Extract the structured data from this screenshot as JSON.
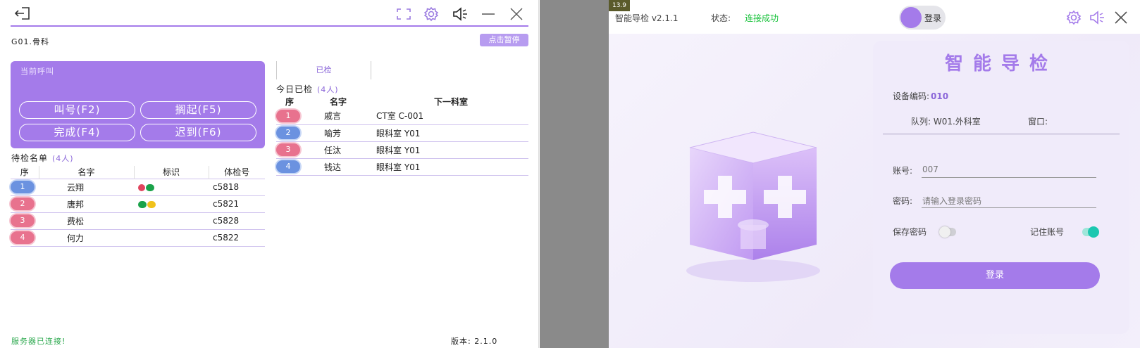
{
  "left": {
    "dept_label": "G01.骨科",
    "pause_button": "点击暂停",
    "call_panel": {
      "title": "当前呼叫",
      "buttons": [
        "叫号(F2)",
        "搁起(F5)",
        "完成(F4)",
        "迟到(F6)"
      ]
    },
    "waiting": {
      "title": "待检名单",
      "count": "(4人)",
      "headers": [
        "序",
        "名字",
        "标识",
        "体检号"
      ],
      "rows": [
        {
          "no": "1",
          "name": "云翔",
          "tags": [
            "heart",
            "green"
          ],
          "exam_id": "c5818",
          "badge": "blue"
        },
        {
          "no": "2",
          "name": "唐邦",
          "tags": [
            "green",
            "yellow"
          ],
          "exam_id": "c5821",
          "badge": "pink"
        },
        {
          "no": "3",
          "name": "费松",
          "tags": [],
          "exam_id": "c5828",
          "badge": "pink"
        },
        {
          "no": "4",
          "name": "何力",
          "tags": [],
          "exam_id": "c5822",
          "badge": "pink"
        }
      ]
    },
    "done_tab": "已检",
    "done": {
      "title": "今日已检",
      "count": "(4人)",
      "headers": [
        "序",
        "名字",
        "下一科室"
      ],
      "rows": [
        {
          "no": "1",
          "name": "戚言",
          "next": "CT室 C-001",
          "badge": "pink"
        },
        {
          "no": "2",
          "name": "喻芳",
          "next": "眼科室 Y01",
          "badge": "blue"
        },
        {
          "no": "3",
          "name": "任汰",
          "next": "眼科室 Y01",
          "badge": "pink"
        },
        {
          "no": "4",
          "name": "钱达",
          "next": "眼科室 Y01",
          "badge": "blue"
        }
      ]
    },
    "status": "服务器已连接!",
    "version": "版本: 2.1.0"
  },
  "right": {
    "fps": "13.9",
    "app_name": "智能导检 v2.1.1",
    "status_label": "状态:",
    "status_value": "连接成功",
    "login_toggle": "登录",
    "card_title": "智能导检",
    "device_label": "设备编码:",
    "device_value": "010",
    "queue_label": "队列: W01.外科室",
    "window_label": "窗口:",
    "account_label": "账号:",
    "account_value": "007",
    "password_label": "密码:",
    "password_placeholder": "请输入登录密码",
    "save_password_label": "保存密码",
    "remember_account_label": "记住账号",
    "login_button": "登录"
  },
  "colors": {
    "accent": "#a47bea",
    "badge_pink": "#e8728e",
    "badge_blue": "#6b92e0",
    "status_green": "#17c23a",
    "toggle_on": "#1cc7b0"
  }
}
